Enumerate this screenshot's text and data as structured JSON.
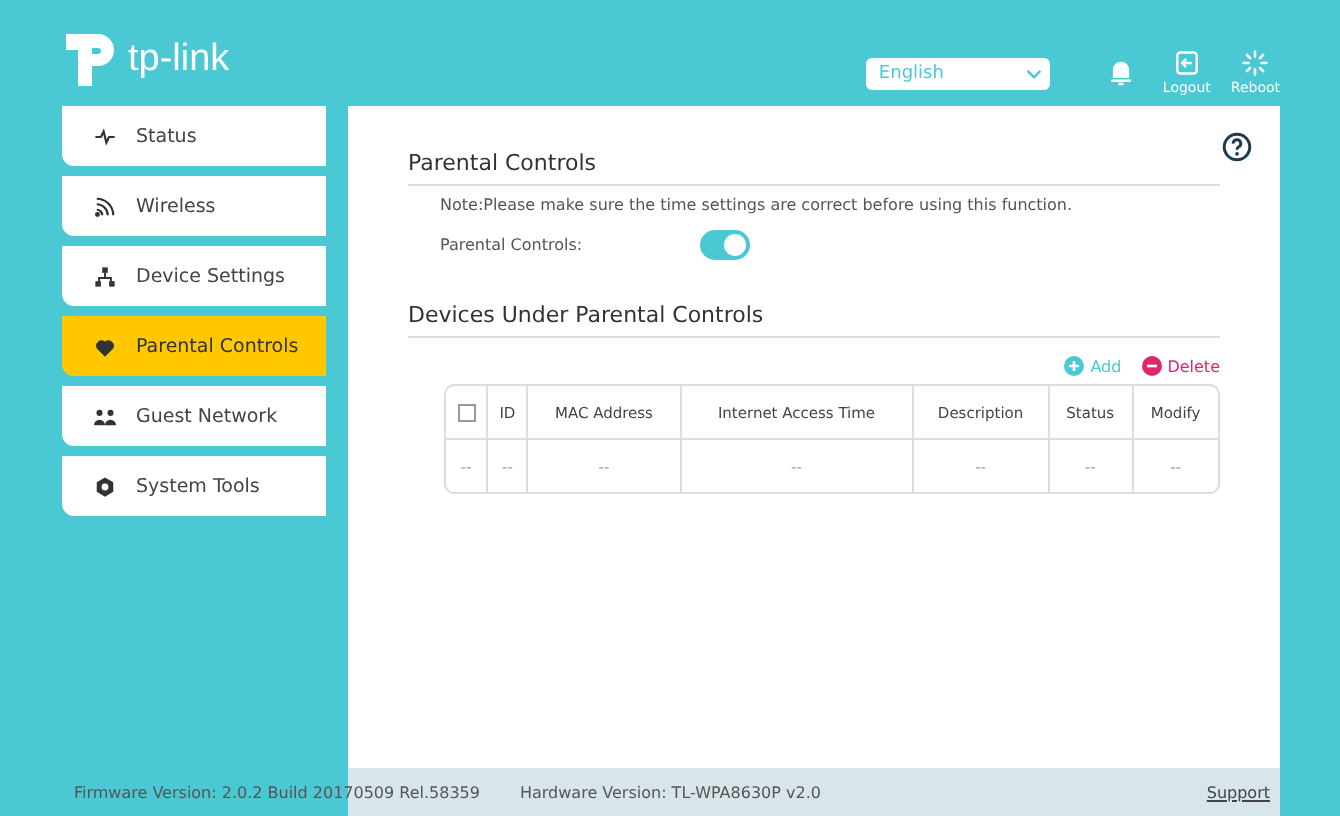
{
  "header": {
    "logo": "tp-link",
    "language": "English",
    "actions": [
      {
        "kind": "bell"
      },
      {
        "kind": "logout",
        "label": "Logout"
      },
      {
        "kind": "reboot",
        "label": "Reboot"
      }
    ]
  },
  "sidebar": {
    "items": [
      {
        "kind": "status",
        "label": "Status",
        "selected": false
      },
      {
        "kind": "wireless",
        "label": "Wireless",
        "selected": false
      },
      {
        "kind": "device",
        "label": "Device Settings",
        "selected": false
      },
      {
        "kind": "parental",
        "label": "Parental Controls",
        "selected": true
      },
      {
        "kind": "guest",
        "label": "Guest Network",
        "selected": false
      },
      {
        "kind": "tools",
        "label": "System Tools",
        "selected": false
      }
    ]
  },
  "main": {
    "section_title": "Parental Controls",
    "note": "Note:Please make sure the time settings are correct before using this function.",
    "toggle": {
      "label": "Parental Controls:",
      "on": true
    },
    "devices_title": "Devices Under Parental Controls",
    "add": "Add",
    "delete": "Delete",
    "table": {
      "select_all_checked": false,
      "columns": [
        "",
        "ID",
        "MAC Address",
        "Internet Access Time",
        "Description",
        "Status",
        "Modify"
      ],
      "rows": [
        [
          "--",
          "--",
          "--",
          "--",
          "--",
          "--",
          "--"
        ]
      ]
    }
  },
  "status_bar": {
    "firmware": "Firmware Version: 2.0.2 Build 20170509 Rel.58359",
    "hardware": "Hardware Version: TL-WPA8630P v2.0",
    "support": "Support"
  }
}
